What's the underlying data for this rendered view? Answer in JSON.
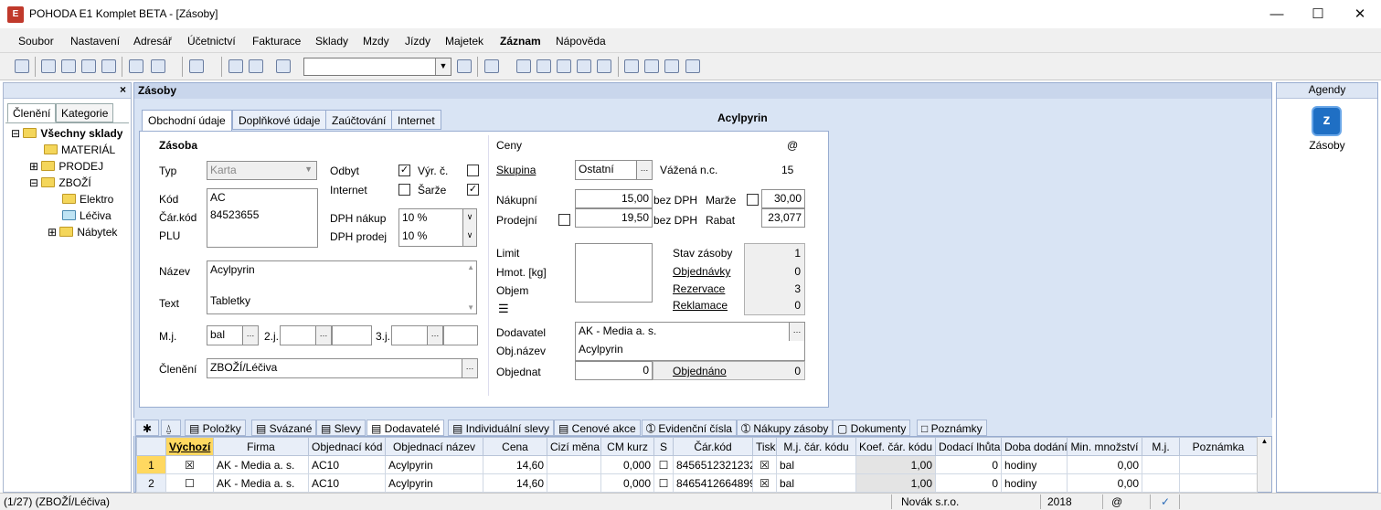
{
  "window": {
    "title": "POHODA E1 Komplet BETA - [Zásoby]",
    "icon_text": "E"
  },
  "menu": [
    "Soubor",
    "Nastavení",
    "Adresář",
    "Účetnictví",
    "Fakturace",
    "Sklady",
    "Mzdy",
    "Jízdy",
    "Majetek",
    "Záznam",
    "Nápověda"
  ],
  "left": {
    "tabs": [
      "Členění",
      "Kategorie"
    ],
    "close": "×",
    "tree": {
      "root": "Všechny sklady",
      "items": [
        "MATERIÁL",
        "PRODEJ",
        "ZBOŽÍ",
        "Elektro",
        "Léčiva",
        "Nábytek"
      ]
    }
  },
  "main": {
    "title": "Zásoby",
    "tabs": [
      "Obchodní údaje",
      "Doplňkové údaje",
      "Zaúčtování",
      "Internet"
    ],
    "record_name": "Acylpyrin",
    "left": {
      "section": "Zásoba",
      "typ_label": "Typ",
      "typ_value": "Karta",
      "odbyt_label": "Odbyt",
      "vyrc_label": "Výr. č.",
      "internet_label": "Internet",
      "sarze_label": "Šarže",
      "kod_label": "Kód",
      "kod_value": "AC",
      "carkod_label": "Čár.kód",
      "carkod_value": "84523655",
      "plu_label": "PLU",
      "dph_nakup_label": "DPH nákup",
      "dph_nakup_value": "10 %",
      "dph_prodej_label": "DPH prodej",
      "dph_prodej_value": "10 %",
      "nazev_label": "Název",
      "nazev_value": "Acylpyrin",
      "text_label": "Text",
      "text_value": "Tabletky",
      "mj_label": "M.j.",
      "mj_value": "bal",
      "mj2_label": "2.j.",
      "mj3_label": "3.j.",
      "cleneni_label": "Členění",
      "cleneni_value": "ZBOŽÍ/Léčiva"
    },
    "right": {
      "ceny_label": "Ceny",
      "at_sign": "@",
      "skupina_label": "Skupina",
      "skupina_value": "Ostatní",
      "vazena_label": "Vážená n.c.",
      "vazena_value": "15",
      "nakupni_label": "Nákupní",
      "nakupni_value": "15,00",
      "bez_dph_1": "bez DPH",
      "marze_label": "Marže",
      "marze_value": "30,00",
      "prodejni_label": "Prodejní",
      "prodejni_value": "19,50",
      "bez_dph_2": "bez DPH",
      "rabat_label": "Rabat",
      "rabat_value": "23,077",
      "limit_label": "Limit",
      "hmot_label": "Hmot. [kg]",
      "objem_label": "Objem",
      "stav_label": "Stav zásoby",
      "stav_value": "1",
      "objednavky_label": "Objednávky",
      "objednavky_value": "0",
      "rezervace_label": "Rezervace",
      "rezervace_value": "3",
      "reklamace_label": "Reklamace",
      "reklamace_value": "0",
      "dodavatel_label": "Dodavatel",
      "dodavatel_value": "AK - Media a. s.",
      "objnazev_label": "Obj.název",
      "objnazev_value": "Acylpyrin",
      "objednat_label": "Objednat",
      "objednat_value": "0",
      "objednano_label": "Objednáno",
      "objednano_value": "0"
    }
  },
  "agenda": {
    "title": "Agendy",
    "item": "Zásoby"
  },
  "bottom_tabs": [
    "Položky",
    "Svázané",
    "Slevy",
    "Dodavatelé",
    "Individuální slevy",
    "Cenové akce",
    "Evidenční čísla",
    "Nákupy zásoby",
    "Dokumenty",
    "Poznámky"
  ],
  "grid": {
    "columns": [
      "Výchozí",
      "Firma",
      "Objednací kód",
      "Objednací název",
      "Cena",
      "Cizí měna",
      "CM kurz",
      "S",
      "Čár.kód",
      "Tisk",
      "M.j. čár. kódu",
      "Koef. čár. kódu",
      "Dodací lhůta",
      "Doba dodání",
      "Min. množství",
      "M.j.",
      "Poznámka"
    ],
    "rows": [
      [
        "1",
        "☒",
        "AK - Media a. s.",
        "AC10",
        "Acylpyrin",
        "14,60",
        "",
        "0,000",
        "☐",
        "8456512321232",
        "☒",
        "bal",
        "1,00",
        "0",
        "hodiny",
        "0,00",
        "",
        ""
      ],
      [
        "2",
        "☐",
        "AK - Media a. s.",
        "AC10",
        "Acylpyrin",
        "14,60",
        "",
        "0,000",
        "☐",
        "8465412664899",
        "☒",
        "bal",
        "1,00",
        "0",
        "hodiny",
        "0,00",
        "",
        ""
      ]
    ]
  },
  "status": {
    "record": "(1/27) (ZBOŽÍ/Léčiva)",
    "company": "Novák s.r.o.",
    "year": "2018",
    "at": "@"
  }
}
